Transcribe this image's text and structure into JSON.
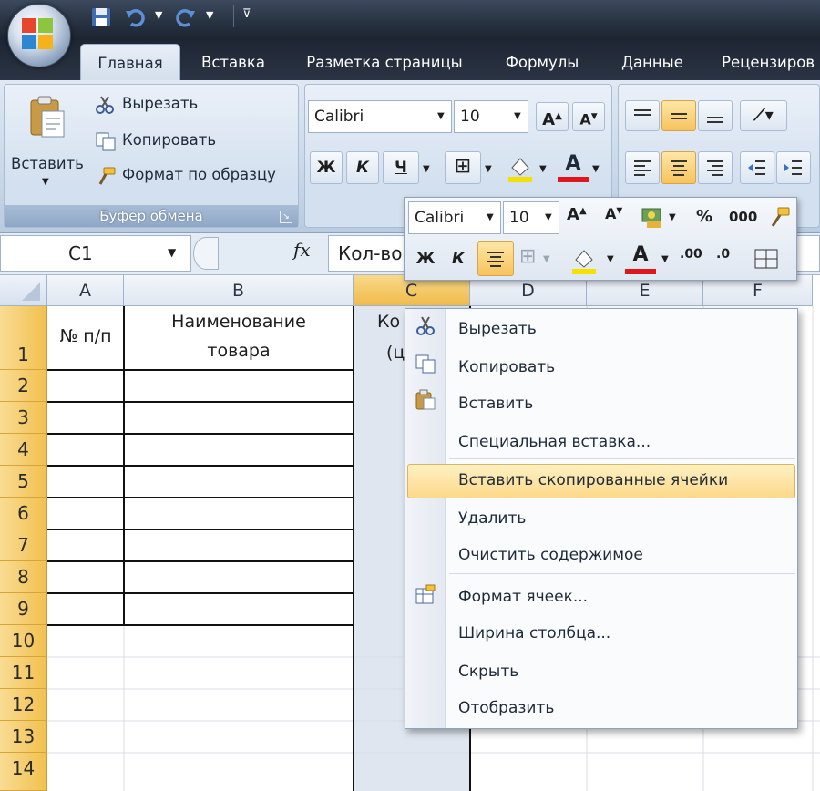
{
  "tabs": [
    {
      "label": "Главная",
      "active": true
    },
    {
      "label": "Вставка"
    },
    {
      "label": "Разметка страницы"
    },
    {
      "label": "Формулы"
    },
    {
      "label": "Данные"
    },
    {
      "label": "Рецензиров"
    }
  ],
  "clipboard": {
    "paste": "Вставить",
    "cut": "Вырезать",
    "copy": "Копировать",
    "format_painter": "Формат по образцу",
    "group_label": "Буфер обмена"
  },
  "font": {
    "name": "Calibri",
    "size": "10",
    "bold": "Ж",
    "italic": "К",
    "underline": "Ч",
    "font_color_glyph": "A"
  },
  "formula_bar": {
    "name_box": "C1",
    "fx": "fx",
    "content": "Кол-во"
  },
  "columns": [
    "A",
    "B",
    "C",
    "D",
    "E",
    "F"
  ],
  "rows": [
    "1",
    "2",
    "3",
    "4",
    "5",
    "6",
    "7",
    "8",
    "9",
    "10",
    "11",
    "12",
    "13",
    "14"
  ],
  "cells": {
    "A1": "№ п/п",
    "B1_line1": "Наименование",
    "B1_line2": "товара",
    "C1_line1": "Ко",
    "C1_line2": "(ц"
  },
  "mini_toolbar": {
    "font": "Calibri",
    "size": "10",
    "percent": "%",
    "thousands": "000",
    "bold": "Ж",
    "italic": "К",
    "font_color_glyph": "A"
  },
  "context_menu": [
    {
      "label": "Вырезать",
      "icon": "scissors-icon"
    },
    {
      "label": "Копировать",
      "icon": "copy-icon"
    },
    {
      "label": "Вставить",
      "icon": "paste-icon"
    },
    {
      "label": "Специальная вставка..."
    },
    {
      "label": "Вставить скопированные ячейки",
      "highlighted": true
    },
    {
      "label": "Удалить"
    },
    {
      "label": "Очистить содержимое"
    },
    {
      "label": "Формат ячеек...",
      "icon": "format-cells-icon"
    },
    {
      "label": "Ширина столбца..."
    },
    {
      "label": "Скрыть"
    },
    {
      "label": "Отобразить"
    }
  ],
  "colors": {
    "row_header": "#f2c04f",
    "highlight": "#fcd98a",
    "font_color": "#e0161a",
    "fill_color": "#f5e000"
  }
}
